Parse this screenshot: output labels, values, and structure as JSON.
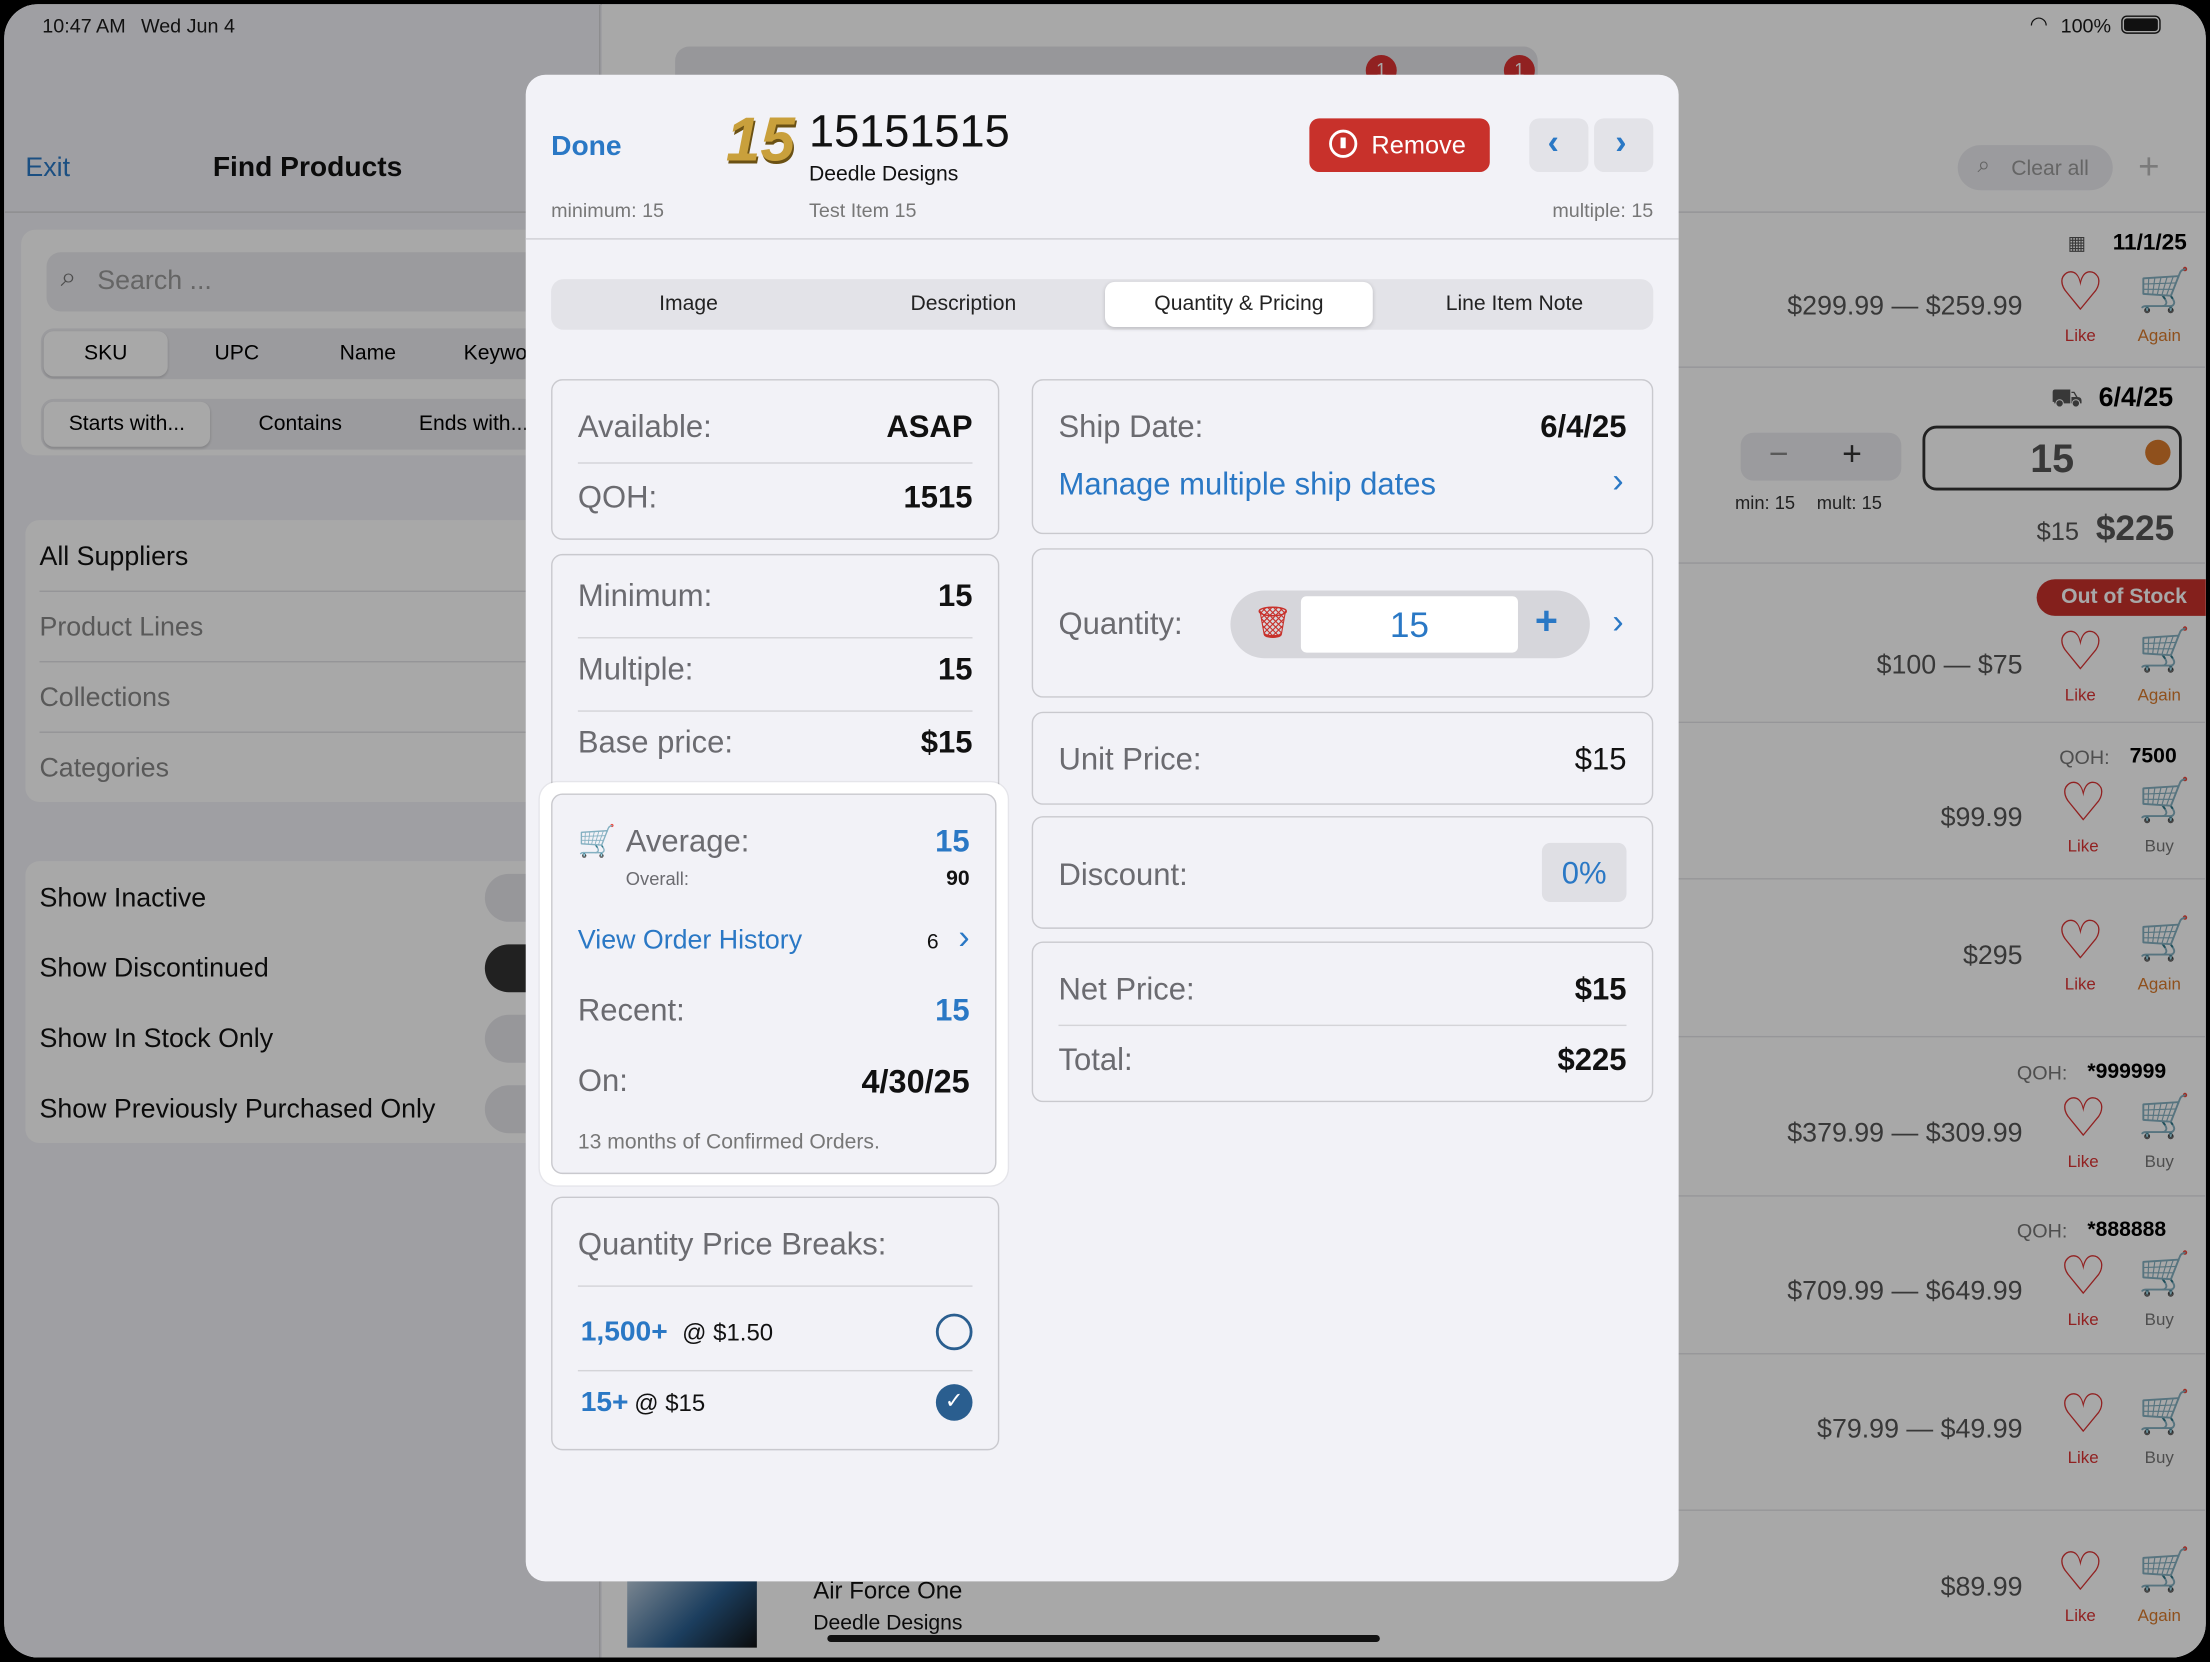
{
  "status": {
    "time": "10:47 AM",
    "date": "Wed Jun 4",
    "battery": "100%"
  },
  "left": {
    "exit": "Exit",
    "title": "Find Products",
    "search_placeholder": "Search ...",
    "search_fields": [
      "SKU",
      "UPC",
      "Name",
      "Keywor"
    ],
    "match_modes": [
      "Starts with...",
      "Contains",
      "Ends with..."
    ],
    "filters": [
      "All Suppliers",
      "Product Lines",
      "Collections",
      "Categories"
    ],
    "toggles": [
      {
        "label": "Show Inactive",
        "on": false
      },
      {
        "label": "Show Discontinued",
        "on": true
      },
      {
        "label": "Show In Stock Only",
        "on": false
      },
      {
        "label": "Show Previously Purchased Only",
        "on": false
      }
    ]
  },
  "right": {
    "tab_badges": [
      "1",
      "1"
    ],
    "clear_all": "Clear all",
    "rows": [
      {
        "date": "11/1/25",
        "price": "$299.99 — $259.99",
        "like": "Like",
        "action": "Again"
      },
      {
        "date": "6/4/25",
        "min": "min: 15",
        "mult": "mult: 15",
        "qty": "15",
        "unit": "$15",
        "total": "$225"
      },
      {
        "badge": "Out of Stock",
        "price": "$100 — $75",
        "like": "Like",
        "action": "Again"
      },
      {
        "qoh_label": "QOH:",
        "qoh": "7500",
        "price": "$99.99",
        "like": "Like",
        "action": "Buy"
      },
      {
        "price": "$295",
        "like": "Like",
        "action": "Again"
      },
      {
        "qoh_label": "QOH:",
        "qoh": "*999999",
        "price": "$379.99 — $309.99",
        "like": "Like",
        "action": "Buy"
      },
      {
        "qoh_label": "QOH:",
        "qoh": "*888888",
        "price": "$709.99 — $649.99",
        "like": "Like",
        "action": "Buy"
      },
      {
        "price": "$79.99 — $49.99",
        "like": "Like",
        "action": "Buy"
      },
      {
        "name": "Air Force One",
        "brand": "Deedle Designs",
        "price": "$89.99",
        "like": "Like",
        "action": "Again"
      }
    ]
  },
  "modal": {
    "done": "Done",
    "logo_text": "15",
    "sku": "15151515",
    "supplier": "Deedle Designs",
    "item_name": "Test Item 15",
    "minimum_note": "minimum: 15",
    "multiple_note": "multiple: 15",
    "remove": "Remove",
    "tabs": [
      "Image",
      "Description",
      "Quantity & Pricing",
      "Line Item Note"
    ],
    "availability": {
      "available_label": "Available:",
      "available": "ASAP",
      "qoh_label": "QOH:",
      "qoh": "1515"
    },
    "rules": {
      "minimum_label": "Minimum:",
      "minimum": "15",
      "multiple_label": "Multiple:",
      "multiple": "15",
      "base_label": "Base price:",
      "base": "$15"
    },
    "history": {
      "average_label": "Average:",
      "average": "15",
      "overall_label": "Overall:",
      "overall": "90",
      "view_history": "View Order History",
      "history_count": "6",
      "recent_label": "Recent:",
      "recent": "15",
      "on_label": "On:",
      "on": "4/30/25",
      "note": "13 months of Confirmed Orders."
    },
    "breaks": {
      "title": "Quantity Price Breaks:",
      "items": [
        {
          "qty": "1,500+",
          "price": "@ $1.50",
          "selected": false
        },
        {
          "qty": "15+",
          "price": "@ $15",
          "selected": true
        }
      ]
    },
    "ship": {
      "label": "Ship Date:",
      "value": "6/4/25",
      "manage": "Manage multiple ship dates"
    },
    "quantity": {
      "label": "Quantity:",
      "value": "15"
    },
    "unit": {
      "label": "Unit Price:",
      "value": "$15"
    },
    "discount": {
      "label": "Discount:",
      "value": "0%"
    },
    "net": {
      "label": "Net Price:",
      "value": "$15",
      "total_label": "Total:",
      "total": "$225"
    }
  },
  "colors": {
    "accent": "#2a78c5",
    "danger": "#c8312b",
    "orange": "#d97a2b"
  }
}
